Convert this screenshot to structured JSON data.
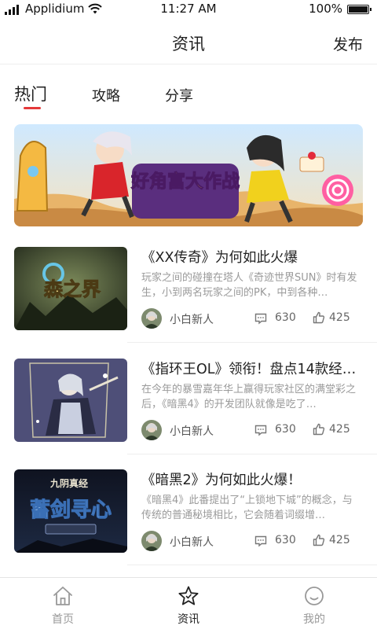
{
  "status_bar": {
    "carrier": "Applidium",
    "time": "11:27 AM",
    "battery": "100%"
  },
  "header": {
    "title": "资讯",
    "publish_label": "发布"
  },
  "tabs": [
    {
      "label": "热门",
      "active": true
    },
    {
      "label": "攻略",
      "active": false
    },
    {
      "label": "分享",
      "active": false
    }
  ],
  "banner": {
    "title": "好角富大作战"
  },
  "articles": [
    {
      "title": "《XX传奇》为何如此火爆",
      "summary": "玩家之间的碰撞在塔人《奇迹世界SUN》时有发生，小到两名玩家之间的PK，中到各种…",
      "thumb_text": "森之界",
      "author": "小白新人",
      "comments": "630",
      "likes": "425"
    },
    {
      "title": "《指环王OL》领衔！盘点14款经…",
      "summary": "在今年的暴雪嘉年华上赢得玩家社区的满堂彩之后，《暗黑4》的开发团队就像是吃了…",
      "author": "小白新人",
      "comments": "630",
      "likes": "425"
    },
    {
      "title": "《暗黑2》为何如此火爆！",
      "summary": "《暗黑4》此番提出了“上锁地下城”的概念，与传统的普通秘境相比，它会随着词缀增…",
      "thumb_text": "蓄剑寻心",
      "thumb_subtext": "九阴真经",
      "author": "小白新人",
      "comments": "630",
      "likes": "425"
    }
  ],
  "bottom_nav": [
    {
      "label": "首页",
      "icon": "home-icon",
      "active": false
    },
    {
      "label": "资讯",
      "icon": "star-icon",
      "active": true
    },
    {
      "label": "我的",
      "icon": "user-icon",
      "active": false
    }
  ],
  "colors": {
    "accent": "#e5393a",
    "text_primary": "#222222",
    "text_secondary": "#9a9a9a",
    "nav_inactive": "#999999"
  }
}
